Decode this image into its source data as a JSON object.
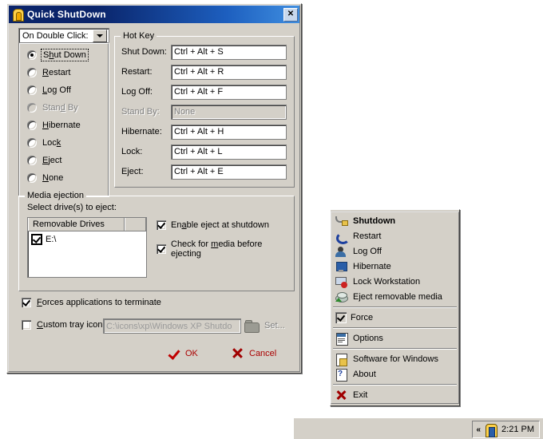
{
  "window": {
    "title": "Quick ShutDown",
    "icon": "door-icon",
    "close_label": "✕"
  },
  "action_combo": {
    "value": "On Double Click:",
    "arrow": "chevron-down-icon"
  },
  "actions": [
    {
      "label_pre": "S",
      "label_accel": "h",
      "label_post": "ut Down",
      "selected": true,
      "enabled": true
    },
    {
      "label_pre": "",
      "label_accel": "R",
      "label_post": "estart",
      "selected": false,
      "enabled": true
    },
    {
      "label_pre": "",
      "label_accel": "L",
      "label_post": "og Off",
      "selected": false,
      "enabled": true
    },
    {
      "label_pre": "Stan",
      "label_accel": "d",
      "label_post": " By",
      "selected": false,
      "enabled": false
    },
    {
      "label_pre": "",
      "label_accel": "H",
      "label_post": "ibernate",
      "selected": false,
      "enabled": true
    },
    {
      "label_pre": "Loc",
      "label_accel": "k",
      "label_post": "",
      "selected": false,
      "enabled": true
    },
    {
      "label_pre": "",
      "label_accel": "E",
      "label_post": "ject",
      "selected": false,
      "enabled": true
    },
    {
      "label_pre": "",
      "label_accel": "N",
      "label_post": "one",
      "selected": false,
      "enabled": true
    }
  ],
  "hotkey_group": {
    "title": "Hot Key",
    "rows": [
      {
        "label": "Shut Down:",
        "value": "Ctrl + Alt + S",
        "enabled": true
      },
      {
        "label": "Restart:",
        "value": "Ctrl + Alt + R",
        "enabled": true
      },
      {
        "label": "Log Off:",
        "value": "Ctrl + Alt + F",
        "enabled": true
      },
      {
        "label": "Stand By:",
        "value": "None",
        "enabled": false
      },
      {
        "label": "Hibernate:",
        "value": "Ctrl + Alt + H",
        "enabled": true
      },
      {
        "label": "Lock:",
        "value": "Ctrl + Alt + L",
        "enabled": true
      },
      {
        "label": "Eject:",
        "value": "Ctrl + Alt + E",
        "enabled": true
      }
    ]
  },
  "media_group": {
    "title": "Media ejection",
    "select_label": "Select drive(s) to eject:",
    "list_header": "Removable Drives",
    "drives": [
      {
        "label": "E:\\",
        "checked": true
      }
    ],
    "options": [
      {
        "pre": "En",
        "accel": "a",
        "post": "ble eject at shutdown",
        "checked": true
      },
      {
        "pre": "Check for ",
        "accel": "m",
        "post": "edia before ejecting",
        "checked": true
      }
    ]
  },
  "bottom": {
    "force_pre": "",
    "force_accel": "F",
    "force_post": "orces applications to terminate",
    "force_checked": true,
    "custom_pre": "",
    "custom_accel": "C",
    "custom_post": "ustom tray icon",
    "custom_checked": false,
    "icon_path": "C:\\icons\\xp\\Windows XP Shutdo",
    "browse_icon": "folder-icon",
    "set_label": "Set...",
    "ok_label": "OK",
    "cancel_label": "Cancel",
    "ok_icon": "check-icon",
    "cancel_icon": "x-icon",
    "accent_color": "#aa0000"
  },
  "menu": {
    "items": [
      {
        "label": "Shutdown",
        "icon": "power-plug-icon",
        "bold": true,
        "kind": "icon"
      },
      {
        "label": "Restart",
        "icon": "restart-arrow-icon",
        "bold": false,
        "kind": "icon"
      },
      {
        "label": "Log Off",
        "icon": "user-icon",
        "bold": false,
        "kind": "icon"
      },
      {
        "label": "Hibernate",
        "icon": "monitor-icon",
        "bold": false,
        "kind": "icon"
      },
      {
        "label": "Lock Workstation",
        "icon": "lock-computer-icon",
        "bold": false,
        "kind": "icon"
      },
      {
        "label": "Eject removable media",
        "icon": "eject-disc-icon",
        "bold": false,
        "kind": "icon"
      },
      {
        "separator": true
      },
      {
        "label": "Force",
        "icon": "checkbox-icon",
        "bold": false,
        "kind": "check",
        "checked": true
      },
      {
        "separator": true
      },
      {
        "label": "Options",
        "icon": "options-page-icon",
        "bold": false,
        "kind": "icon"
      },
      {
        "separator": true
      },
      {
        "label": "Software for Windows",
        "icon": "software-page-icon",
        "bold": false,
        "kind": "icon"
      },
      {
        "label": "About",
        "icon": "about-help-icon",
        "bold": false,
        "kind": "icon"
      },
      {
        "separator": true
      },
      {
        "label": "Exit",
        "icon": "exit-x-icon",
        "bold": false,
        "kind": "icon"
      }
    ]
  },
  "taskbar": {
    "chevron": "«",
    "tray_icon": "quick-shutdown-tray-icon",
    "clock": "2:21 PM"
  }
}
